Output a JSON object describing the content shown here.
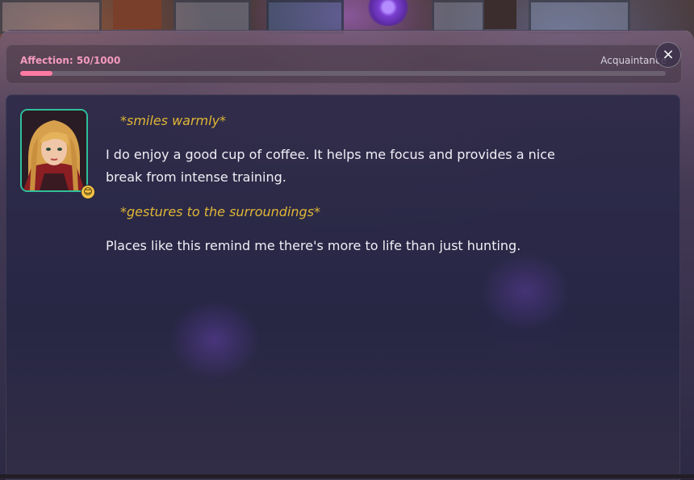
{
  "affection": {
    "label": "Affection: 50/1000",
    "current": 50,
    "max": 1000,
    "rank": "Acquaintance"
  },
  "close_label": "×",
  "character": {
    "mood_emoji": "😊",
    "avatar_icon": "portrait-icon"
  },
  "messages": [
    {
      "type": "action",
      "text": "*smiles warmly*"
    },
    {
      "type": "speech",
      "text": "I do enjoy a good cup of coffee. It helps me focus and provides a nice break from intense training."
    },
    {
      "type": "action",
      "text": "*gestures to the surroundings*"
    },
    {
      "type": "speech",
      "text": "Places like this remind me there's more to life than just hunting."
    }
  ],
  "colors": {
    "affection_label": "#f49ac0",
    "affection_fill": "#ff7aa2",
    "action_text": "#e0b636",
    "avatar_border": "#2fbf9a"
  }
}
